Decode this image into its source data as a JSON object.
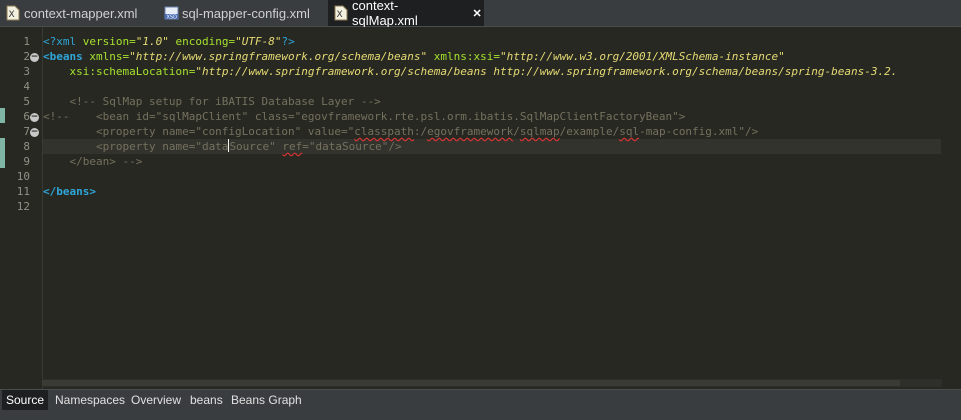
{
  "tabs": [
    {
      "label": "context-mapper.xml",
      "icon": "xml-file-icon",
      "active": false
    },
    {
      "label": "sql-mapper-config.xml",
      "icon": "xml-config-file-icon",
      "active": false
    },
    {
      "label": "context-sqlMap.xml",
      "icon": "xml-file-icon",
      "active": true
    }
  ],
  "line_numbers": [
    "1",
    "2",
    "3",
    "4",
    "5",
    "6",
    "7",
    "8",
    "9",
    "10",
    "11",
    "12"
  ],
  "code": {
    "l1": {
      "pi_open": "<?xml",
      "a1": " version=",
      "v1": "\"1.0\"",
      "a2": " encoding=",
      "v2": "\"UTF-8\"",
      "pi_close": "?>"
    },
    "l2": {
      "tag": "<beans",
      "a1": " xmlns=",
      "v1": "\"http://www.springframework.org/schema/beans\"",
      "a2": " xmlns:xsi=",
      "v2": "\"http://www.w3.org/2001/XMLSchema-instance\""
    },
    "l3": {
      "indent": "    ",
      "a1": "xsi:schemaLocation=",
      "v1": "\"http://www.springframework.org/schema/beans http://www.springframework.org/schema/beans/spring-beans-3.2.",
      "close": ">"
    },
    "l5": "    <!-- SqlMap setup for iBATIS Database Layer -->",
    "l6": "<!--    <bean id=\"sqlMapClient\" class=\"egovframework.rte.psl.orm.ibatis.SqlMapClientFactoryBean\">",
    "l7": {
      "p1": "        <property name=\"configLocation\" value=\"",
      "w1": "classpath",
      "p2": ":/",
      "w2": "egovframework",
      "p3": "/",
      "w3": "sqlmap",
      "p4": "/example/",
      "w4": "sql",
      "p5": "-map-config.xml\"/>"
    },
    "l8": {
      "p1": "        <property name=\"data",
      "p2": "Source\" ",
      "w1": "ref",
      "p3": "=\"dataSource\"/>"
    },
    "l9": "    </bean> -->",
    "l11": "</beans>"
  },
  "bottom_tabs": [
    {
      "label": "Source",
      "active": true
    },
    {
      "label": "Namespaces",
      "active": false
    },
    {
      "label": "Overview",
      "active": false
    },
    {
      "label": "beans",
      "active": false
    },
    {
      "label": "Beans Graph",
      "active": false
    }
  ],
  "colors": {
    "editor_bg": "#272822",
    "tag": "#2fa6d8",
    "attribute": "#a6e22e",
    "value": "#e6db74",
    "comment": "#75715e"
  }
}
